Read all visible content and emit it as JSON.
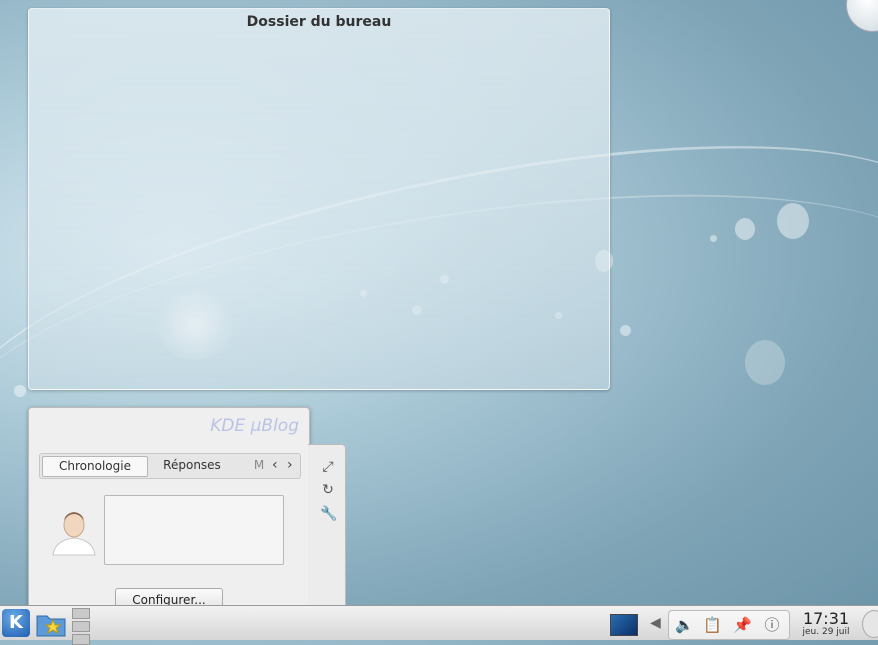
{
  "folder_view": {
    "title": "Dossier du bureau"
  },
  "microblog": {
    "logo": "KDE µBlog",
    "tabs": [
      {
        "label": "Chronologie"
      },
      {
        "label": "Réponses"
      },
      {
        "label": "M"
      }
    ],
    "configure_label": "Configurer...",
    "handle_icons": [
      "maximize-icon",
      "refresh-icon",
      "wrench-icon"
    ]
  },
  "panel": {
    "launcher_glyph": "K",
    "clock": {
      "time": "17:31",
      "date": "jeu. 29 juil"
    },
    "tray_icons": [
      "volume-icon",
      "clipboard-icon",
      "pin-icon",
      "info-icon"
    ]
  },
  "colors": {
    "accent": "#1d5eb1",
    "wallpaper": "#7ea4b6"
  }
}
